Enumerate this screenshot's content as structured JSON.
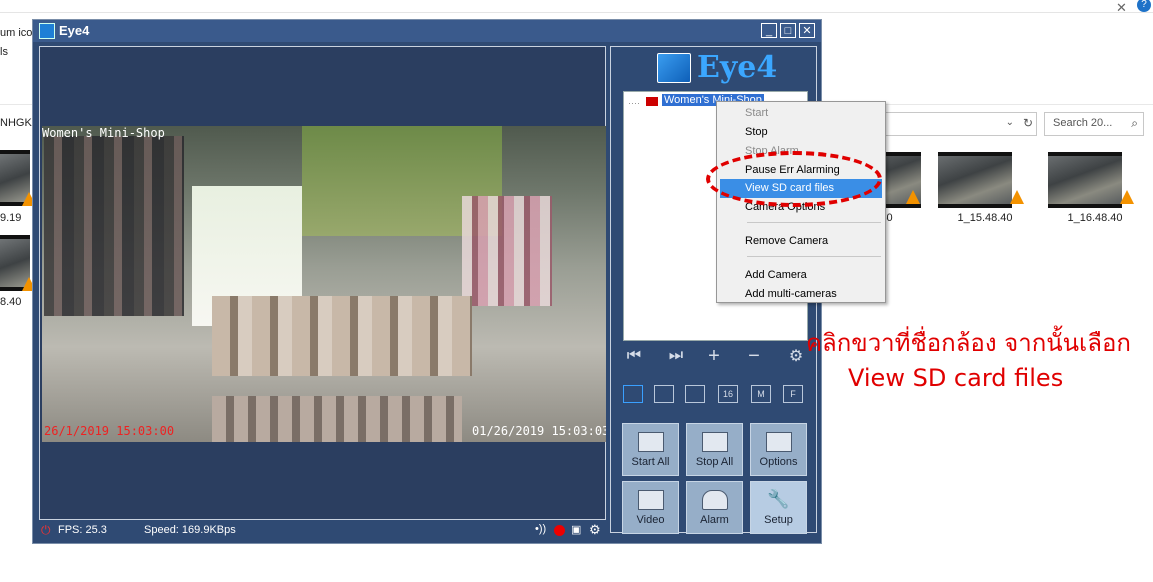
{
  "background": {
    "left_texts": [
      "um ico",
      "ls",
      "NHGK"
    ],
    "left_file_labels": [
      "9.19",
      "8.40"
    ],
    "search_placeholder": "Search 20...",
    "thumbnails": [
      {
        "label": ".40"
      },
      {
        "label": "1_15.48.40"
      },
      {
        "label": "1_16.48.40"
      }
    ]
  },
  "window": {
    "title": "Eye4",
    "controls": {
      "minimize": "_",
      "maximize": "□",
      "close": "✕"
    }
  },
  "video": {
    "osd_name": "Women's Mini-Shop",
    "osd_date_red": "26/1/2019 15:03:00",
    "osd_date_white": "01/26/2019 15:03:03"
  },
  "status": {
    "fps": "FPS: 25.3",
    "speed": "Speed: 169.9KBps"
  },
  "panel": {
    "logo_text": "Eye4",
    "tree_camera": "Women's Mini-Shop",
    "view_buttons": [
      "",
      "",
      "",
      "16",
      "M",
      "F"
    ],
    "buttons": [
      {
        "label": "Start All"
      },
      {
        "label": "Stop All"
      },
      {
        "label": "Options"
      },
      {
        "label": "Video"
      },
      {
        "label": "Alarm"
      },
      {
        "label": "Setup"
      }
    ]
  },
  "context_menu": {
    "items": [
      {
        "label": "Start",
        "disabled": true
      },
      {
        "label": "Stop",
        "disabled": false
      },
      {
        "label": "Stop Alarm",
        "disabled": true
      },
      {
        "label": "Pause Err Alarming",
        "disabled": false
      },
      {
        "label": "View SD card files",
        "disabled": false,
        "highlighted": true
      },
      {
        "label": "Camera Options",
        "disabled": false
      },
      {
        "label": "Remove Camera",
        "disabled": false
      },
      {
        "label": "Add Camera",
        "disabled": false
      },
      {
        "label": "Add multi-cameras",
        "disabled": false
      }
    ]
  },
  "annotation": {
    "line1": "คลิกขวาที่ชื่อกล้อง จากนั้นเลือก",
    "line2": "View SD card  files"
  },
  "colors": {
    "accent_red": "#e00000",
    "highlight_blue": "#3a8ee6",
    "panel_bg": "#2f4a73"
  }
}
